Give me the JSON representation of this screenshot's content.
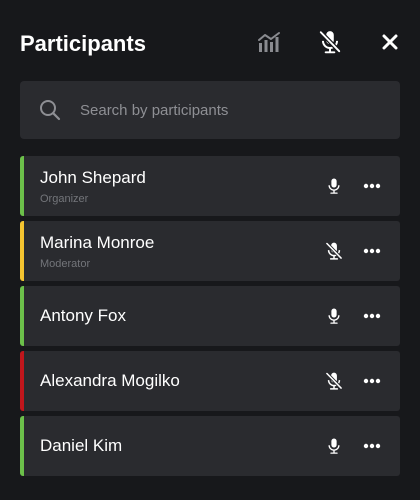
{
  "header": {
    "title": "Participants",
    "icons": {
      "stats": "bar-chart-icon",
      "mute_all": "mic-off-icon",
      "close": "close-icon"
    }
  },
  "search": {
    "placeholder": "Search by participants",
    "value": "",
    "icon": "search-icon"
  },
  "participants": [
    {
      "name": "John Shepard",
      "role": "Organizer",
      "mic": "on",
      "status_color": "#6cc04a"
    },
    {
      "name": "Marina Monroe",
      "role": "Moderator",
      "mic": "muted",
      "status_color": "#f4c430"
    },
    {
      "name": "Antony Fox",
      "role": "",
      "mic": "on",
      "status_color": "#6cc04a"
    },
    {
      "name": "Alexandra Mogilko",
      "role": "",
      "mic": "muted",
      "status_color": "#c0161c"
    },
    {
      "name": "Daniel Kim",
      "role": "",
      "mic": "on",
      "status_color": "#6cc04a"
    }
  ],
  "colors": {
    "background": "#17181b",
    "card": "#2a2b2f",
    "text": "#ffffff",
    "muted_text": "#73757a",
    "placeholder": "#8e8f94",
    "icon_dim": "#8a8b90"
  }
}
